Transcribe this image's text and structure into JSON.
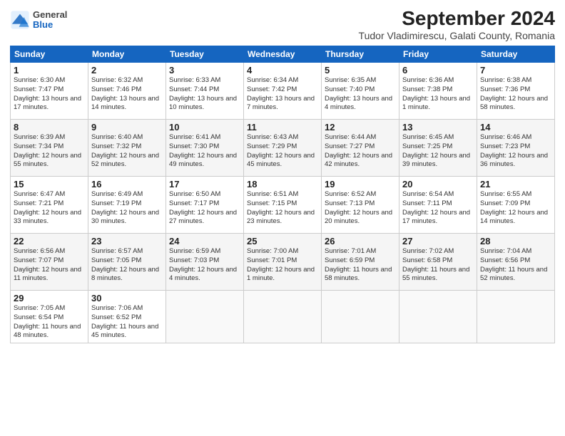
{
  "header": {
    "logo_general": "General",
    "logo_blue": "Blue",
    "title": "September 2024",
    "subtitle": "Tudor Vladimirescu, Galati County, Romania"
  },
  "days_of_week": [
    "Sunday",
    "Monday",
    "Tuesday",
    "Wednesday",
    "Thursday",
    "Friday",
    "Saturday"
  ],
  "weeks": [
    [
      {
        "day": "1",
        "info": "Sunrise: 6:30 AM\nSunset: 7:47 PM\nDaylight: 13 hours and 17 minutes."
      },
      {
        "day": "2",
        "info": "Sunrise: 6:32 AM\nSunset: 7:46 PM\nDaylight: 13 hours and 14 minutes."
      },
      {
        "day": "3",
        "info": "Sunrise: 6:33 AM\nSunset: 7:44 PM\nDaylight: 13 hours and 10 minutes."
      },
      {
        "day": "4",
        "info": "Sunrise: 6:34 AM\nSunset: 7:42 PM\nDaylight: 13 hours and 7 minutes."
      },
      {
        "day": "5",
        "info": "Sunrise: 6:35 AM\nSunset: 7:40 PM\nDaylight: 13 hours and 4 minutes."
      },
      {
        "day": "6",
        "info": "Sunrise: 6:36 AM\nSunset: 7:38 PM\nDaylight: 13 hours and 1 minute."
      },
      {
        "day": "7",
        "info": "Sunrise: 6:38 AM\nSunset: 7:36 PM\nDaylight: 12 hours and 58 minutes."
      }
    ],
    [
      {
        "day": "8",
        "info": "Sunrise: 6:39 AM\nSunset: 7:34 PM\nDaylight: 12 hours and 55 minutes."
      },
      {
        "day": "9",
        "info": "Sunrise: 6:40 AM\nSunset: 7:32 PM\nDaylight: 12 hours and 52 minutes."
      },
      {
        "day": "10",
        "info": "Sunrise: 6:41 AM\nSunset: 7:30 PM\nDaylight: 12 hours and 49 minutes."
      },
      {
        "day": "11",
        "info": "Sunrise: 6:43 AM\nSunset: 7:29 PM\nDaylight: 12 hours and 45 minutes."
      },
      {
        "day": "12",
        "info": "Sunrise: 6:44 AM\nSunset: 7:27 PM\nDaylight: 12 hours and 42 minutes."
      },
      {
        "day": "13",
        "info": "Sunrise: 6:45 AM\nSunset: 7:25 PM\nDaylight: 12 hours and 39 minutes."
      },
      {
        "day": "14",
        "info": "Sunrise: 6:46 AM\nSunset: 7:23 PM\nDaylight: 12 hours and 36 minutes."
      }
    ],
    [
      {
        "day": "15",
        "info": "Sunrise: 6:47 AM\nSunset: 7:21 PM\nDaylight: 12 hours and 33 minutes."
      },
      {
        "day": "16",
        "info": "Sunrise: 6:49 AM\nSunset: 7:19 PM\nDaylight: 12 hours and 30 minutes."
      },
      {
        "day": "17",
        "info": "Sunrise: 6:50 AM\nSunset: 7:17 PM\nDaylight: 12 hours and 27 minutes."
      },
      {
        "day": "18",
        "info": "Sunrise: 6:51 AM\nSunset: 7:15 PM\nDaylight: 12 hours and 23 minutes."
      },
      {
        "day": "19",
        "info": "Sunrise: 6:52 AM\nSunset: 7:13 PM\nDaylight: 12 hours and 20 minutes."
      },
      {
        "day": "20",
        "info": "Sunrise: 6:54 AM\nSunset: 7:11 PM\nDaylight: 12 hours and 17 minutes."
      },
      {
        "day": "21",
        "info": "Sunrise: 6:55 AM\nSunset: 7:09 PM\nDaylight: 12 hours and 14 minutes."
      }
    ],
    [
      {
        "day": "22",
        "info": "Sunrise: 6:56 AM\nSunset: 7:07 PM\nDaylight: 12 hours and 11 minutes."
      },
      {
        "day": "23",
        "info": "Sunrise: 6:57 AM\nSunset: 7:05 PM\nDaylight: 12 hours and 8 minutes."
      },
      {
        "day": "24",
        "info": "Sunrise: 6:59 AM\nSunset: 7:03 PM\nDaylight: 12 hours and 4 minutes."
      },
      {
        "day": "25",
        "info": "Sunrise: 7:00 AM\nSunset: 7:01 PM\nDaylight: 12 hours and 1 minute."
      },
      {
        "day": "26",
        "info": "Sunrise: 7:01 AM\nSunset: 6:59 PM\nDaylight: 11 hours and 58 minutes."
      },
      {
        "day": "27",
        "info": "Sunrise: 7:02 AM\nSunset: 6:58 PM\nDaylight: 11 hours and 55 minutes."
      },
      {
        "day": "28",
        "info": "Sunrise: 7:04 AM\nSunset: 6:56 PM\nDaylight: 11 hours and 52 minutes."
      }
    ],
    [
      {
        "day": "29",
        "info": "Sunrise: 7:05 AM\nSunset: 6:54 PM\nDaylight: 11 hours and 48 minutes."
      },
      {
        "day": "30",
        "info": "Sunrise: 7:06 AM\nSunset: 6:52 PM\nDaylight: 11 hours and 45 minutes."
      },
      {
        "day": "",
        "info": ""
      },
      {
        "day": "",
        "info": ""
      },
      {
        "day": "",
        "info": ""
      },
      {
        "day": "",
        "info": ""
      },
      {
        "day": "",
        "info": ""
      }
    ]
  ]
}
